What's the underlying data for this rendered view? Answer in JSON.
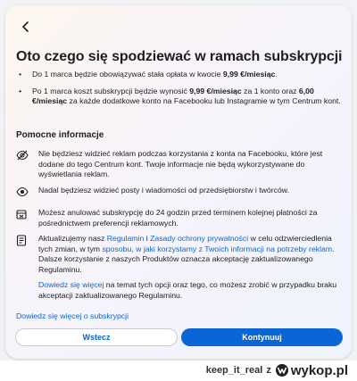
{
  "dialog": {
    "title": "Oto czego się spodziewać w ramach subskrypcji",
    "bullets": [
      {
        "pre": "Do 1 marca będzie obowiązywać stała opłata w kwocie ",
        "bold": "9,99 €/miesiąc",
        "post": "."
      },
      {
        "pre": "Po 1 marca koszt subskrypcji będzie wynosić ",
        "bold1": "9,99 €/miesiąc",
        "mid": " za 1 konto oraz ",
        "bold2": "6,00 €/miesiąc",
        "post": " za każde dodatkowe konto na Facebooku lub Instagramie w tym Centrum kont."
      }
    ],
    "helpful_title": "Pomocne informacje",
    "info": [
      "Nie będziesz widzieć reklam podczas korzystania z konta na Facebooku, które jest dodane do tego Centrum kont. Twoje informacje nie będą wykorzystywane do wyświetlania reklam.",
      "Nadal będziesz widzieć posty i wiadomości od przedsiębiorstw i twórców.",
      "Możesz anulować subskrypcję do 24 godzin przed terminem kolejnej płatności za pośrednictwem preferencji reklamowych."
    ],
    "terms": {
      "t1": "Aktualizujemy nasz ",
      "l1": "Regulamin",
      "t2": " i ",
      "l2": "Zasady ochrony prywatności",
      "t3": " w celu odzwierciedlenia tych zmian, w tym ",
      "l3": "sposobu, w jaki korzystamy z Twoich informacji na potrzeby reklam",
      "t4": ". Dalsze korzystanie z naszych Produktów oznacza akceptację zaktualizowanego Regulaminu."
    },
    "terms_sub": {
      "link": "Dowiedz się więcej",
      "text": " na temat tych opcji oraz tego, co możesz zrobić w przypadku braku akceptacji zaktualizowanego Regulaminu."
    },
    "more_link": "Dowiedz się więcej o subskrypcji",
    "back_button": "Wstecz",
    "continue_button": "Kontynuuj"
  },
  "watermark": {
    "user": "keep_it_real",
    "sep": "z",
    "site": "wykop.pl"
  },
  "colors": {
    "accent": "#0a66d6",
    "text": "#1c1e21"
  }
}
